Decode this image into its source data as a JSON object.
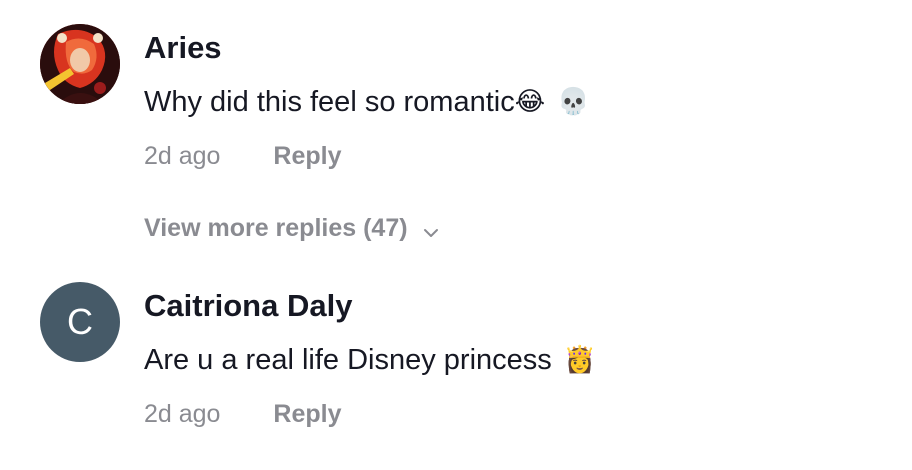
{
  "comments": [
    {
      "username": "Aries",
      "text": "Why did this feel so romantic",
      "emoji_1": "😂",
      "emoji_2": "💀",
      "time": "2d ago",
      "reply_label": "Reply",
      "view_more": "View more replies (47)",
      "avatar_icon": "profile-picture-icon"
    },
    {
      "username": "Caitriona Daly",
      "avatar_letter": "C",
      "text": "Are u a real life Disney princess",
      "emoji_1": "👸",
      "time": "2d ago",
      "reply_label": "Reply"
    }
  ],
  "colors": {
    "text_primary": "#161823",
    "text_secondary": "#8a8b91",
    "avatar_fallback": "#465a68"
  }
}
